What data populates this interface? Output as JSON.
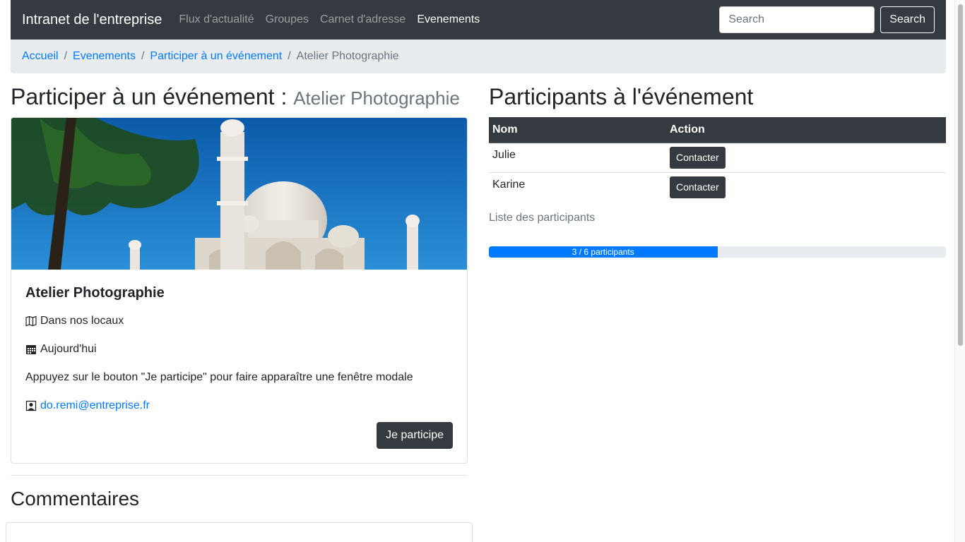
{
  "navbar": {
    "brand": "Intranet de l'entreprise",
    "links": [
      {
        "label": "Flux d'actualité",
        "active": false
      },
      {
        "label": "Groupes",
        "active": false
      },
      {
        "label": "Carnet d'adresse",
        "active": false
      },
      {
        "label": "Evenements",
        "active": true
      }
    ],
    "search_placeholder": "Search",
    "search_button": "Search"
  },
  "breadcrumb": {
    "items": [
      "Accueil",
      "Evenements",
      "Participer à un événement"
    ],
    "current": "Atelier Photographie",
    "separator": "/"
  },
  "event": {
    "heading": "Participer à un événement :",
    "heading_sub": "Atelier Photographie",
    "title": "Atelier Photographie",
    "location": "Dans nos locaux",
    "date": "Aujourd'hui",
    "description": "Appuyez sur le bouton \"Je participe\" pour faire apparaître une fenêtre modale",
    "contact_email": "do.remi@entreprise.fr",
    "participate_button": "Je participe",
    "image_icon": "taj-mahal-photo"
  },
  "comments": {
    "title": "Commentaires"
  },
  "participants": {
    "title": "Participants à l'événement",
    "columns": [
      "Nom",
      "Action"
    ],
    "rows": [
      {
        "name": "Julie",
        "action": "Contacter"
      },
      {
        "name": "Karine",
        "action": "Contacter"
      }
    ],
    "list_label": "Liste des participants",
    "progress_text": "3 / 6 participants",
    "progress_fraction": 0.5
  },
  "colors": {
    "dark": "#343a40",
    "primary": "#007bff",
    "muted": "#6c757d",
    "light_bg": "#e9ecef"
  }
}
